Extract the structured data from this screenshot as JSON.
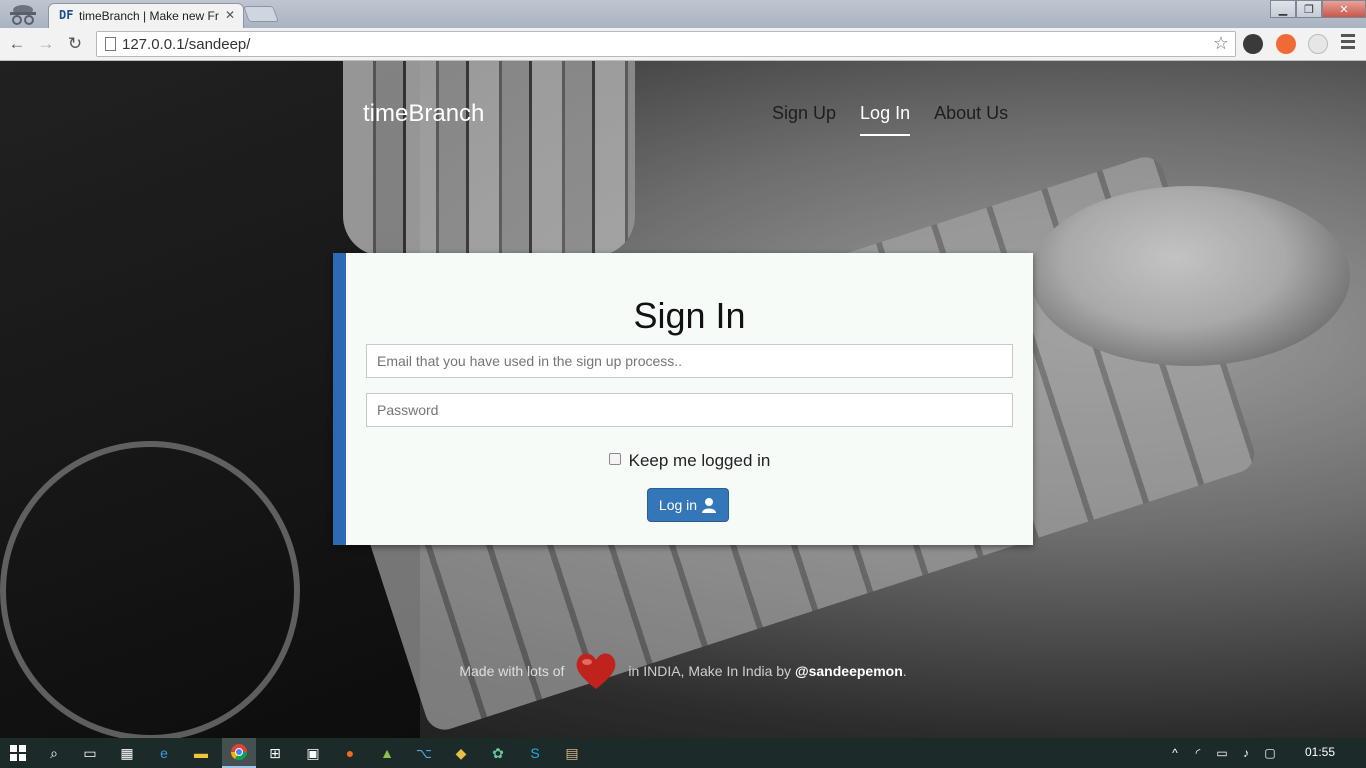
{
  "browser": {
    "tab_title": "timeBranch | Make new Fr",
    "tab_favicon": "DF",
    "url": "127.0.0.1/sandeep/"
  },
  "icons": {
    "back": "arrow-left-icon",
    "forward": "arrow-right-icon",
    "reload": "reload-icon",
    "star": "star-icon",
    "menu": "hamburger-icon"
  },
  "site": {
    "brand": "timeBranch",
    "nav": [
      {
        "label": "Sign Up",
        "active": false
      },
      {
        "label": "Log In",
        "active": true
      },
      {
        "label": "About Us",
        "active": false
      }
    ]
  },
  "signin": {
    "title": "Sign In",
    "email_placeholder": "Email that you have used in the sign up process..",
    "password_placeholder": "Password",
    "remember_label": "Keep me logged in",
    "login_label": "Log in"
  },
  "footer": {
    "prefix": "Made with lots of",
    "suffix": "in INDIA, Make In India by",
    "handle": "@sandeepemon",
    "end": "."
  },
  "taskbar": {
    "clock": "01:55"
  },
  "colors": {
    "accent": "#2c6bb3",
    "button": "#3477b8",
    "taskbar": "#1c2b2a"
  }
}
